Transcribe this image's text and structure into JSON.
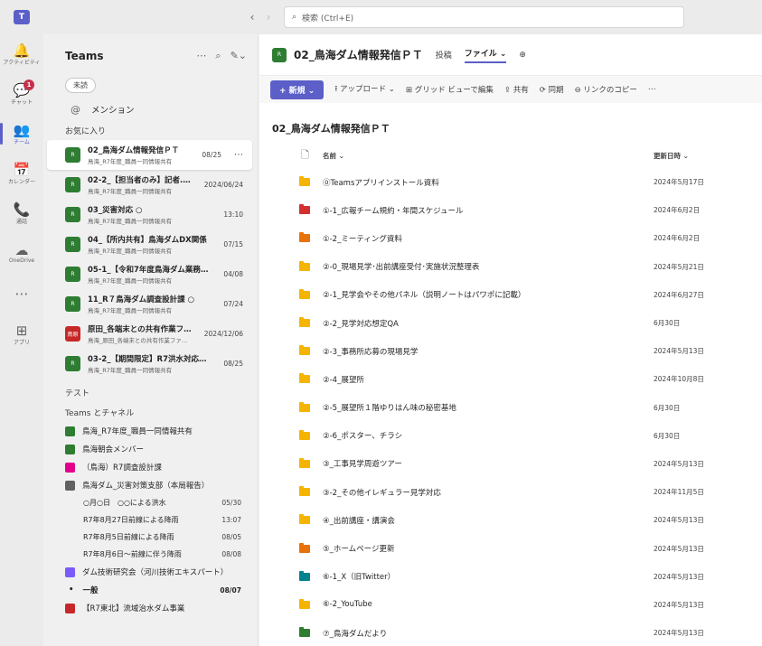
{
  "search": {
    "placeholder": "検索 (Ctrl+E)"
  },
  "rail": [
    {
      "icon": "bell-icon",
      "glyph": "🔔",
      "label": "アクティビティ"
    },
    {
      "icon": "chat-icon",
      "glyph": "💬",
      "label": "チャット",
      "badge": "1"
    },
    {
      "icon": "teams-icon",
      "glyph": "👥",
      "label": "チーム"
    },
    {
      "icon": "calendar-icon",
      "glyph": "📅",
      "label": "カレンダー"
    },
    {
      "icon": "call-icon",
      "glyph": "📞",
      "label": "通話"
    },
    {
      "icon": "onedrive-icon",
      "glyph": "☁",
      "label": "OneDrive"
    },
    {
      "icon": "more-icon",
      "glyph": "⋯",
      "label": ""
    },
    {
      "icon": "apps-icon",
      "glyph": "⊞",
      "label": "アプリ"
    }
  ],
  "sidebar": {
    "title": "Teams",
    "filter": "未読",
    "mention": "メンション",
    "favorites_label": "お気に入り",
    "favorites": [
      {
        "name": "02_鳥海ダム情報発信ＰＴ",
        "sub": "鳥海_R7年度_職員一同情報共有",
        "date": "08/25",
        "avatar": "R"
      },
      {
        "name": "02-2_【担当者のみ】記者...  ○",
        "sub": "鳥海_R7年度_職員一同情報共有",
        "date": "2024/06/24",
        "avatar": "R"
      },
      {
        "name": "03_災害対応  ○",
        "sub": "鳥海_R7年度_職員一同情報共有",
        "date": "13:10",
        "avatar": "R"
      },
      {
        "name": "04_【所内共有】鳥海ダムDX関係",
        "sub": "鳥海_R7年度_職員一同情報共有",
        "date": "07/15",
        "avatar": "R"
      },
      {
        "name": "05-1_【令和7年度鳥海ダム業務進...",
        "sub": "鳥海_R7年度_職員一同情報共有",
        "date": "04/08",
        "avatar": "R"
      },
      {
        "name": "11_R７鳥海ダム調査設計課  ○",
        "sub": "鳥海_R7年度_職員一同情報共有",
        "date": "07/24",
        "avatar": "R"
      },
      {
        "name": "原田_各端末との共有作業ファ...",
        "sub": "鳥海_原田_各端末との共有作業ファイル",
        "date": "2024/12/06",
        "avatar": "鳥原"
      },
      {
        "name": "03-2_【期間限定】R7洪水対応演...",
        "sub": "鳥海_R7年度_職員一同情報共有",
        "date": "08/25",
        "avatar": "R"
      }
    ],
    "test_label": "テスト",
    "teams_label": "Teams とチャネル",
    "teams": [
      {
        "name": "鳥海_R7年度_職員一同情報共有"
      },
      {
        "name": "鳥海朝会メンバー"
      },
      {
        "name": "（鳥海）R7調査設計課"
      },
      {
        "name": "鳥海ダム_災害対策支部（本局報告）"
      }
    ],
    "channels": [
      {
        "name": "○月○日　○○による洪水",
        "date": "05/30"
      },
      {
        "name": "R7年8月27日前線による降雨",
        "date": "13:07"
      },
      {
        "name": "R7年8月5日前線による降雨",
        "date": "08/05"
      },
      {
        "name": "R7年8月6日～前線に伴う降雨",
        "date": "08/08"
      }
    ],
    "team5": "ダム技術研究会（河川技術エキスパート）",
    "general": {
      "name": "一般",
      "date": "08/07"
    },
    "team6": "【R7東北】流域治水ダム事業"
  },
  "main": {
    "title": "02_鳥海ダム情報発信ＰＴ",
    "tab_posts": "投稿",
    "tab_files": "ファイル ⌄",
    "toolbar": {
      "new": "+ 新規 ⌄",
      "upload": "⭱ アップロード ⌄",
      "grid": "⊞ グリッド ビューで編集",
      "share": "⇪ 共有",
      "sync": "⟳ 同期",
      "link": "⊖ リンクのコピー",
      "more": "⋯"
    },
    "breadcrumb": "02_鳥海ダム情報発信ＰＴ",
    "col_name": "名前 ⌄",
    "col_date": "更新日時 ⌄"
  },
  "files": [
    {
      "name": "⓪Teamsアプリインストール資料",
      "date": "2024年5月17日",
      "color": "#f4b400"
    },
    {
      "name": "①-1_広報チーム規約・年間スケジュール",
      "date": "2024年6月2日",
      "color": "#d32f2f"
    },
    {
      "name": "①-2_ミーティング資料",
      "date": "2024年6月2日",
      "color": "#e8710a"
    },
    {
      "name": "②-0_現場見学･出前講座受付･実施状況整理表",
      "date": "2024年5月21日",
      "color": "#f4b400"
    },
    {
      "name": "②-1_見学会やその他パネル（説明ノートはパワポに記載）",
      "date": "2024年6月27日",
      "color": "#f4b400"
    },
    {
      "name": "②-2_見学対応想定QA",
      "date": "6月30日",
      "color": "#f4b400"
    },
    {
      "name": "②-3_事務所応募の現場見学",
      "date": "2024年5月13日",
      "color": "#f4b400"
    },
    {
      "name": "②-4_展望所",
      "date": "2024年10月8日",
      "color": "#f4b400"
    },
    {
      "name": "②-5_展望所１階ゆりはん味の秘密基地",
      "date": "6月30日",
      "color": "#f4b400"
    },
    {
      "name": "②-6_ポスター、チラシ",
      "date": "6月30日",
      "color": "#f4b400"
    },
    {
      "name": "③_工事見学周遊ツアー",
      "date": "2024年5月13日",
      "color": "#f4b400"
    },
    {
      "name": "③-2_その他イレギュラー見学対応",
      "date": "2024年11月5日",
      "color": "#f4b400"
    },
    {
      "name": "④_出前講座・講演会",
      "date": "2024年5月13日",
      "color": "#f4b400"
    },
    {
      "name": "⑤_ホームページ更新",
      "date": "2024年5月13日",
      "color": "#e8710a"
    },
    {
      "name": "⑥-1_X（旧Twitter）",
      "date": "2024年5月13日",
      "color": "#00838f"
    },
    {
      "name": "⑥-2_YouTube",
      "date": "2024年5月13日",
      "color": "#f4b400"
    },
    {
      "name": "⑦_鳥海ダムだより",
      "date": "2024年5月13日",
      "color": "#2e7d32"
    }
  ]
}
